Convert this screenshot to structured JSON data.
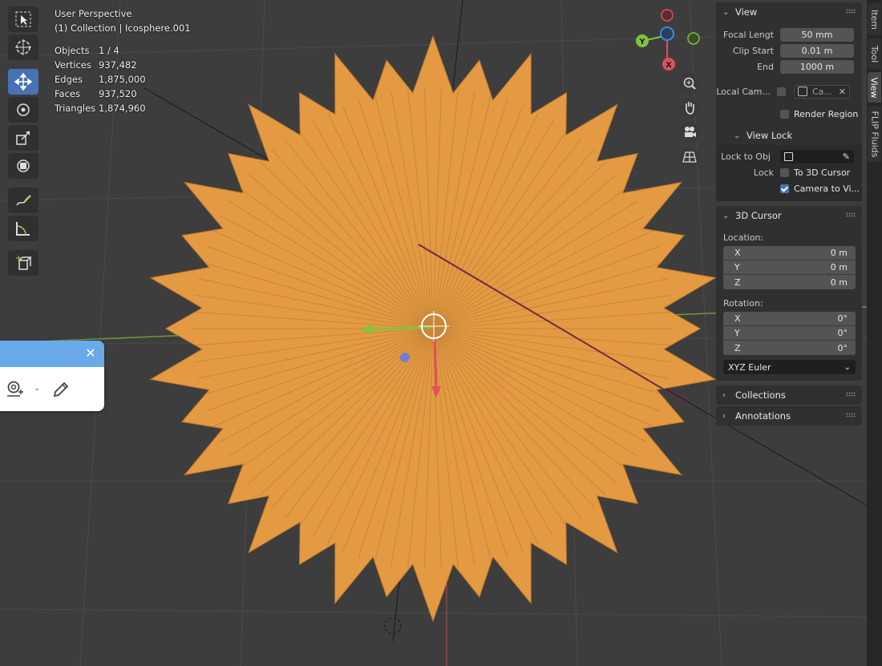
{
  "viewport": {
    "view_name": "User Perspective",
    "collection_line": "(1) Collection | Icosphere.001",
    "stats": [
      {
        "label": "Objects",
        "value": "1 / 4"
      },
      {
        "label": "Vertices",
        "value": "937,482"
      },
      {
        "label": "Edges",
        "value": "1,875,000"
      },
      {
        "label": "Faces",
        "value": "937,520"
      },
      {
        "label": "Triangles",
        "value": "1,874,960"
      }
    ],
    "mesh_color": "#e39a42"
  },
  "toolbar": {
    "tools": [
      "select-box-icon",
      "cursor-icon",
      "move-icon",
      "rotate-icon",
      "scale-icon",
      "transform-icon",
      "annotate-icon",
      "measure-icon",
      "add-cube-icon"
    ],
    "active_tool": "move-icon"
  },
  "gizmo": {
    "axes": {
      "x": "X",
      "y": "Y"
    },
    "colors": {
      "x": "#e34e5d",
      "y": "#7ec33e",
      "z": "#3f87e0"
    }
  },
  "sidebar": {
    "view": {
      "title": "View",
      "focal_label": "Focal Lengt",
      "focal_value": "50 mm",
      "clip_start_label": "Clip Start",
      "clip_start_value": "0.01 m",
      "end_label": "End",
      "end_value": "1000 m",
      "local_camera_label": "Local Cam...",
      "local_camera_value": "Ca...",
      "render_region_label": "Render Region"
    },
    "view_lock": {
      "title": "View Lock",
      "lock_to_obj_label": "Lock to Obj",
      "lock_label": "Lock",
      "to_3d_cursor_label": "To 3D Cursor",
      "camera_to_view_label": "Camera to Vi..."
    },
    "cursor": {
      "title": "3D Cursor",
      "location_label": "Location:",
      "location": [
        {
          "axis": "X",
          "value": "0 m"
        },
        {
          "axis": "Y",
          "value": "0 m"
        },
        {
          "axis": "Z",
          "value": "0 m"
        }
      ],
      "rotation_label": "Rotation:",
      "rotation": [
        {
          "axis": "X",
          "value": "0°"
        },
        {
          "axis": "Y",
          "value": "0°"
        },
        {
          "axis": "Z",
          "value": "0°"
        }
      ],
      "rotation_mode": "XYZ Euler"
    },
    "collections_title": "Collections",
    "annotations_title": "Annotations"
  },
  "tabs": [
    "Item",
    "Tool",
    "View",
    "FLIP Fluids"
  ],
  "active_tab": "View",
  "accent_color": "#4772b3"
}
